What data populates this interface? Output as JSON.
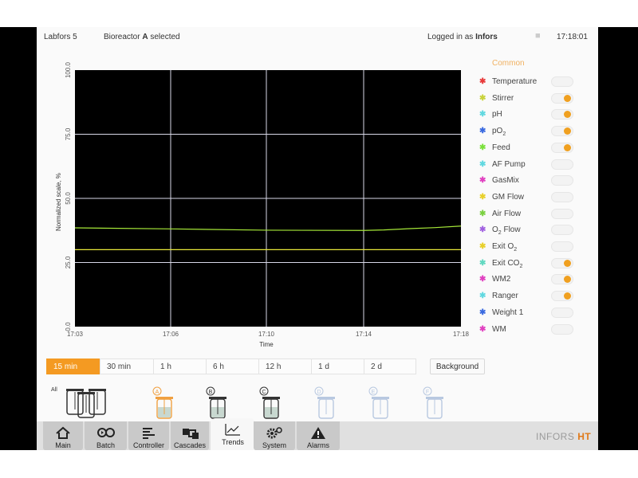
{
  "topbar": {
    "device": "Labfors 5",
    "bioreactor_prefix": "Bioreactor",
    "bioreactor_id": "A",
    "bioreactor_suffix": "selected",
    "logged_prefix": "Logged in as",
    "user": "Infors",
    "time": "17:18:01"
  },
  "legend": {
    "heading": "Common",
    "items": [
      {
        "label": "Temperature",
        "color": "#e83a3a",
        "on": false
      },
      {
        "label": "Stirrer",
        "color": "#c8d23a",
        "on": true
      },
      {
        "label": "pH",
        "color": "#60d8e0",
        "on": true
      },
      {
        "label": "pO",
        "sub": "2",
        "color": "#3a6ae0",
        "on": true
      },
      {
        "label": "Feed",
        "color": "#7ae03a",
        "on": true
      },
      {
        "label": "AF Pump",
        "color": "#60d8e0",
        "on": false
      },
      {
        "label": "GasMix",
        "color": "#e040c0",
        "on": false
      },
      {
        "label": "GM Flow",
        "color": "#e8d02a",
        "on": false
      },
      {
        "label": "Air Flow",
        "color": "#7ad040",
        "on": false
      },
      {
        "label": "O",
        "sub": "2",
        "suffix": " Flow",
        "color": "#a060e0",
        "on": false
      },
      {
        "label": "Exit O",
        "sub": "2",
        "color": "#e8d02a",
        "on": false
      },
      {
        "label": "Exit CO",
        "sub": "2",
        "color": "#60d8c0",
        "on": true
      },
      {
        "label": "WM2",
        "color": "#e040c0",
        "on": true
      },
      {
        "label": "Ranger",
        "color": "#60d8e0",
        "on": true
      },
      {
        "label": "Weight 1",
        "color": "#3a6ae0",
        "on": false
      },
      {
        "label": "WM",
        "color": "#e040c0",
        "on": false
      }
    ]
  },
  "chart_data": {
    "type": "line",
    "xlabel": "Time",
    "ylabel": "Normalized scale, %",
    "x_ticks": [
      "17:03",
      "17:06",
      "17:10",
      "17:14",
      "17:18"
    ],
    "y_ticks": [
      "0.0",
      "25.0",
      "50.0",
      "75.0",
      "100.0"
    ],
    "ylim": [
      0,
      100
    ],
    "grid": true,
    "series": [
      {
        "color": "#a6e838",
        "x": [
          "17:03",
          "17:06",
          "17:10",
          "17:14",
          "17:15",
          "17:16",
          "17:17",
          "17:18"
        ],
        "values": [
          38.5,
          38.1,
          37.6,
          37.5,
          37.7,
          38.2,
          38.6,
          39.2
        ]
      },
      {
        "color": "#e8e83a",
        "x": [
          "17:03",
          "17:18"
        ],
        "values": [
          30.0,
          30.0
        ]
      }
    ]
  },
  "ranges": {
    "items": [
      "15 min",
      "30 min",
      "1 h",
      "6 h",
      "12 h",
      "1 d",
      "2 d"
    ],
    "active_index": 0,
    "background_label": "Background"
  },
  "vessels": {
    "all_label": "All",
    "items": [
      {
        "id": "A",
        "color": "#f0a040",
        "active": true
      },
      {
        "id": "B",
        "color": "#333333",
        "active": true
      },
      {
        "id": "C",
        "color": "#333333",
        "active": true
      },
      {
        "id": "D",
        "color": "#b8c8e0",
        "active": false
      },
      {
        "id": "E",
        "color": "#b8c8e0",
        "active": false
      },
      {
        "id": "F",
        "color": "#b8c8e0",
        "active": false
      }
    ]
  },
  "nav": {
    "tabs": [
      {
        "label": "Main",
        "icon": "home-icon"
      },
      {
        "label": "Batch",
        "icon": "batch-icon"
      },
      {
        "label": "Controller",
        "icon": "controller-icon"
      },
      {
        "label": "Cascades",
        "icon": "cascades-icon"
      },
      {
        "label": "Trends",
        "icon": "trends-icon"
      },
      {
        "label": "System",
        "icon": "gears-icon"
      },
      {
        "label": "Alarms",
        "icon": "warning-icon"
      }
    ],
    "active_index": 4
  },
  "logo": {
    "part1": "INFORS",
    "part2": "HT"
  }
}
